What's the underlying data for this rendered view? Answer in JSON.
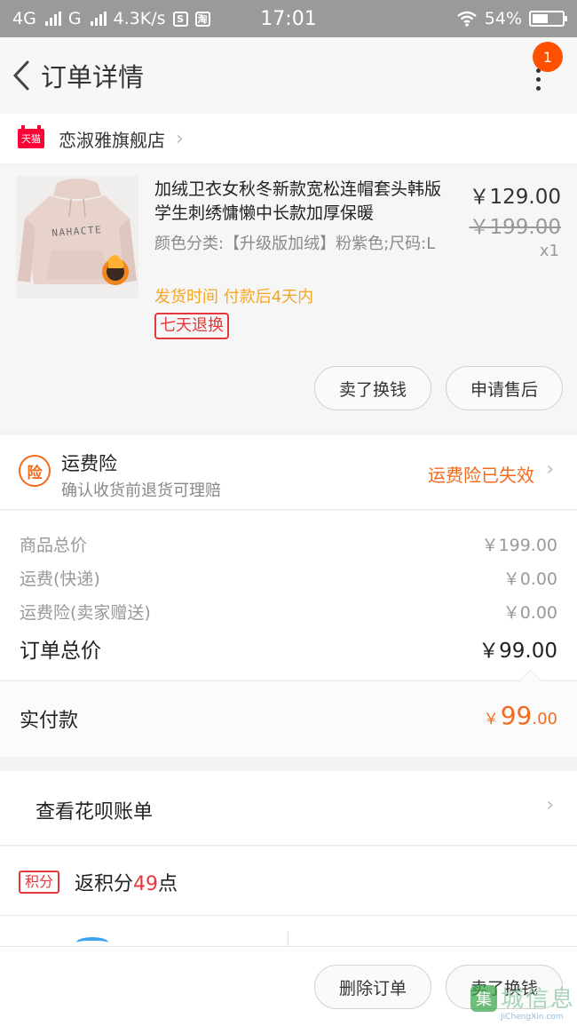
{
  "status_bar": {
    "net1": "4G",
    "net2": "G",
    "speed": "4.3K/s",
    "time": "17:01",
    "battery": "54%",
    "battery_level": 0.54
  },
  "nav": {
    "title": "订单详情",
    "badge_count": "1"
  },
  "shop": {
    "tag": "天猫",
    "name": "恋淑雅旗舰店"
  },
  "item": {
    "title": "加绒卫衣女秋冬新款宽松连帽套头韩版学生刺绣慵懒中长款加厚保暖",
    "sku": "颜色分类:【升级版加绒】粉紫色;尺码:L",
    "ship_time": "发货时间 付款后4天内",
    "service_tag": "七天退换",
    "price": "￥129.00",
    "original_price": "￥199.00",
    "quantity": "x1",
    "thumb_text": "NAHACTE",
    "btn_sell": "卖了换钱",
    "btn_after_sale": "申请售后"
  },
  "insurance": {
    "icon": "险",
    "title": "运费险",
    "subtitle": "确认收货前退货可理赔",
    "status": "运费险已失效"
  },
  "summary": {
    "rows": [
      {
        "label": "商品总价",
        "value": "￥199.00"
      },
      {
        "label": "运费(快递)",
        "value": "￥0.00"
      },
      {
        "label": "运费险(卖家赠送)",
        "value": "￥0.00"
      }
    ],
    "total_label": "订单总价",
    "total_value": "￥99.00"
  },
  "paid": {
    "label": "实付款",
    "currency": "￥",
    "integer": "99",
    "decimal": ".00"
  },
  "huabei": {
    "label": "查看花呗账单"
  },
  "points": {
    "tag": "积分",
    "prefix": "返积分",
    "amount": "49",
    "suffix": "点"
  },
  "footer": {
    "btn_delete": "删除订单",
    "btn_sell": "卖了换钱"
  },
  "colors": {
    "accent_orange": "#f26b1d",
    "tmall_red": "#ff0036",
    "tag_red": "#e4393c",
    "ship_yellow": "#f5a623"
  }
}
